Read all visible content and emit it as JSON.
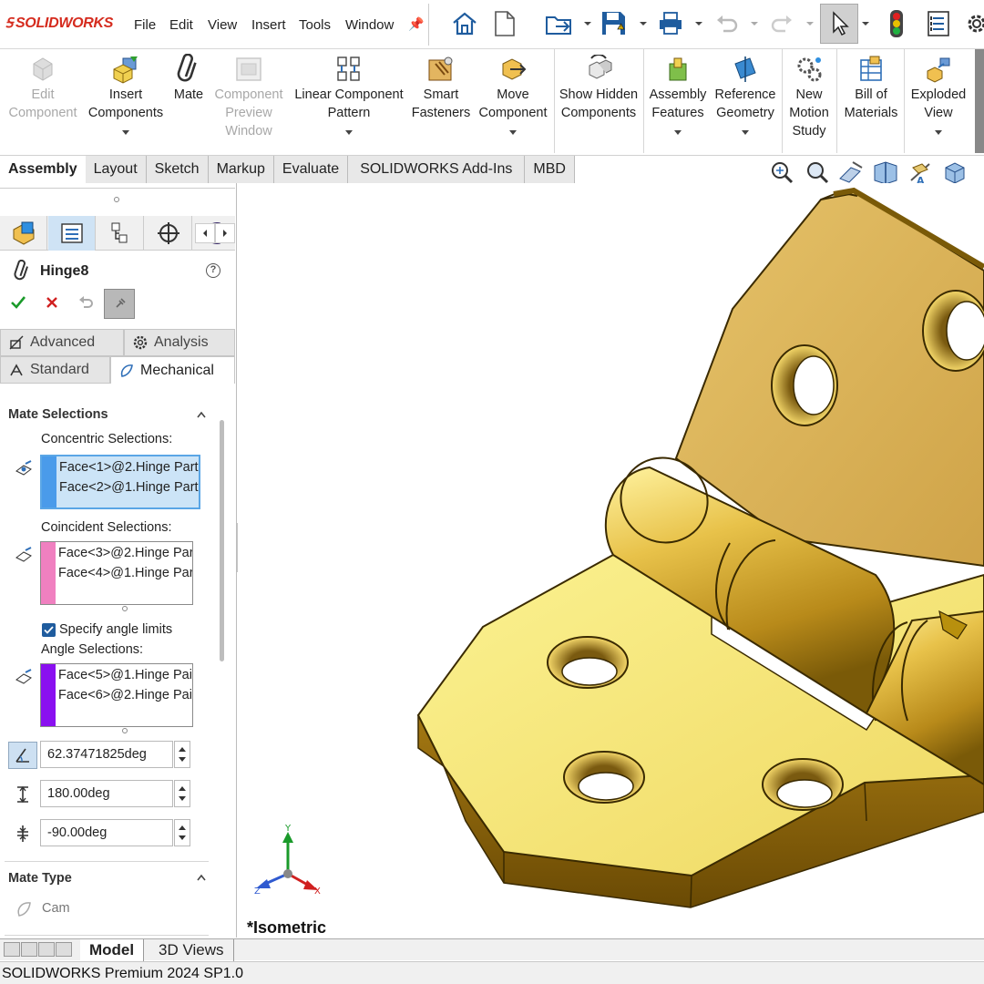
{
  "app": {
    "logo": "SOLIDWORKS",
    "menus": [
      "File",
      "Edit",
      "View",
      "Insert",
      "Tools",
      "Window"
    ]
  },
  "ribbon": {
    "buttons": [
      {
        "label": "Edit Component",
        "icon": "edit-component-icon",
        "disabled": true
      },
      {
        "label": "Insert Components",
        "icon": "insert-components-icon",
        "disabled": false
      },
      {
        "label": "Mate",
        "icon": "mate-paperclip-icon",
        "disabled": false
      },
      {
        "label": "Component Preview Window",
        "icon": "component-preview-icon",
        "disabled": true
      },
      {
        "label": "Linear Component Pattern",
        "icon": "linear-pattern-icon",
        "disabled": false
      },
      {
        "label": "Smart Fasteners",
        "icon": "smart-fasteners-icon",
        "disabled": false
      },
      {
        "label": "Move Component",
        "icon": "move-component-icon",
        "disabled": false
      },
      {
        "label": "Show Hidden Components",
        "icon": "show-hidden-icon",
        "disabled": false
      },
      {
        "label": "Assembly Features",
        "icon": "assembly-features-icon",
        "disabled": false
      },
      {
        "label": "Reference Geometry",
        "icon": "reference-geometry-icon",
        "disabled": false
      },
      {
        "label": "New Motion Study",
        "icon": "motion-study-icon",
        "disabled": false
      },
      {
        "label": "Bill of Materials",
        "icon": "bill-of-materials-icon",
        "disabled": false
      },
      {
        "label": "Exploded View",
        "icon": "exploded-view-icon",
        "disabled": false
      }
    ]
  },
  "command_tabs": [
    "Assembly",
    "Layout",
    "Sketch",
    "Markup",
    "Evaluate",
    "SOLIDWORKS Add-Ins",
    "MBD"
  ],
  "property_manager": {
    "title": "Hinge8",
    "tabs_row1": [
      "Advanced",
      "Analysis"
    ],
    "tabs_row2": [
      "Standard",
      "Mechanical"
    ],
    "mate_selections": {
      "heading": "Mate Selections",
      "concentric_label": "Concentric Selections:",
      "concentric": [
        "Face<1>@2.Hinge Part",
        "Face<2>@1.Hinge Part"
      ],
      "coincident_label": "Coincident Selections:",
      "coincident": [
        "Face<3>@2.Hinge Par",
        "Face<4>@1.Hinge Par"
      ],
      "specify_angle_limits": "Specify angle limits",
      "specify_angle_limits_checked": true,
      "angle_label": "Angle Selections:",
      "angle": [
        "Face<5>@1.Hinge Pai",
        "Face<6>@2.Hinge Pai"
      ],
      "angle_value": "62.37471825deg",
      "max_angle": "180.00deg",
      "min_angle": "-90.00deg"
    },
    "mate_type": {
      "heading": "Mate Type",
      "first_item": "Cam"
    }
  },
  "graphics": {
    "view_name": "*Isometric",
    "triad": {
      "x": "X",
      "y": "Y",
      "z": "Z"
    }
  },
  "bottom_tabs": [
    "Model",
    "3D Views"
  ],
  "status_bar": "SOLIDWORKS Premium 2024 SP1.0",
  "colors": {
    "brand_red": "#d52b1e",
    "brass_light": "#f3e77a",
    "brass_mid": "#d8b040",
    "brass_dark": "#7a5a08",
    "selection_blue": "#4a9bea",
    "selection_pink": "#f080c0",
    "selection_purple": "#8a10f0"
  }
}
